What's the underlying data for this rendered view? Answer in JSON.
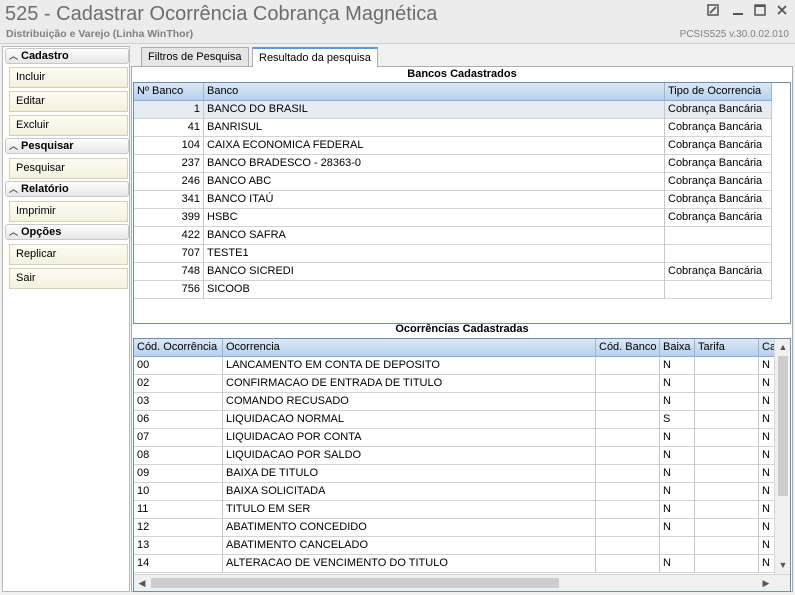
{
  "window": {
    "title": "525 - Cadastrar Ocorrência Cobrança Magnética",
    "subtitle": "Distribuição e Varejo (Linha WinThor)",
    "version": "PCSIS525  v.30.0.02.010",
    "controls": [
      "edit-icon",
      "minimize-icon",
      "maximize-icon",
      "close-icon"
    ]
  },
  "sidebar": {
    "sections": [
      {
        "title": "Cadastro",
        "items": [
          "Incluir",
          "Editar",
          "Excluir"
        ]
      },
      {
        "title": "Pesquisar",
        "items": [
          "Pesquisar"
        ]
      },
      {
        "title": "Relatório",
        "items": [
          "Imprimir"
        ]
      },
      {
        "title": "Opções",
        "items": [
          "Replicar",
          "Sair"
        ]
      }
    ]
  },
  "tabs": [
    {
      "label": "Filtros de Pesquisa",
      "active": false
    },
    {
      "label": "Resultado da pesquisa",
      "active": true
    }
  ],
  "banks": {
    "caption": "Bancos Cadastrados",
    "columns": [
      "Nº Banco",
      "Banco",
      "Tipo de Ocorrencia"
    ],
    "rows": [
      [
        "1",
        "BANCO DO BRASIL",
        "Cobrança Bancária"
      ],
      [
        "41",
        "BANRISUL",
        "Cobrança Bancária"
      ],
      [
        "104",
        "CAIXA ECONOMICA FEDERAL",
        "Cobrança Bancária"
      ],
      [
        "237",
        "BANCO BRADESCO - 28363-0",
        "Cobrança Bancária"
      ],
      [
        "246",
        "BANCO ABC",
        "Cobrança Bancária"
      ],
      [
        "341",
        "BANCO ITAÚ",
        "Cobrança Bancária"
      ],
      [
        "399",
        "HSBC",
        "Cobrança Bancária"
      ],
      [
        "422",
        "BANCO SAFRA",
        ""
      ],
      [
        "707",
        "TESTE1",
        ""
      ],
      [
        "748",
        "BANCO SICREDI",
        "Cobrança Bancária"
      ],
      [
        "756",
        "SICOOB",
        ""
      ]
    ],
    "selected_row": 0
  },
  "occurrences": {
    "caption": "Ocorrências Cadastradas",
    "columns": [
      "Cód. Ocorrência",
      "Ocorrencia",
      "Cód. Banco",
      "Baixa",
      "Tarifa",
      "Ca"
    ],
    "rows": [
      [
        "00",
        "LANCAMENTO EM CONTA DE DEPOSITO",
        "",
        "N",
        "",
        "N"
      ],
      [
        "02",
        "CONFIRMACAO DE ENTRADA DE TITULO",
        "",
        "N",
        "",
        "N"
      ],
      [
        "03",
        "COMANDO RECUSADO",
        "",
        "N",
        "",
        "N"
      ],
      [
        "06",
        "LIQUIDACAO NORMAL",
        "",
        "S",
        "",
        "N"
      ],
      [
        "07",
        "LIQUIDACAO POR CONTA",
        "",
        "N",
        "",
        "N"
      ],
      [
        "08",
        "LIQUIDACAO POR SALDO",
        "",
        "N",
        "",
        "N"
      ],
      [
        "09",
        "BAIXA DE TITULO",
        "",
        "N",
        "",
        "N"
      ],
      [
        "10",
        "BAIXA SOLICITADA",
        "",
        "N",
        "",
        "N"
      ],
      [
        "11",
        "TITULO EM SER",
        "",
        "N",
        "",
        "N"
      ],
      [
        "12",
        "ABATIMENTO CONCEDIDO",
        "",
        "N",
        "",
        "N"
      ],
      [
        "13",
        "ABATIMENTO CANCELADO",
        "",
        "",
        "",
        "N"
      ],
      [
        "14",
        "ALTERACAO DE VENCIMENTO DO TITULO",
        "",
        "N",
        "",
        "N"
      ]
    ]
  },
  "colors": {
    "grid_header": "#c8dcf4",
    "tab_accent": "#5b9bd5",
    "selected_row": "#e6ecf3"
  }
}
